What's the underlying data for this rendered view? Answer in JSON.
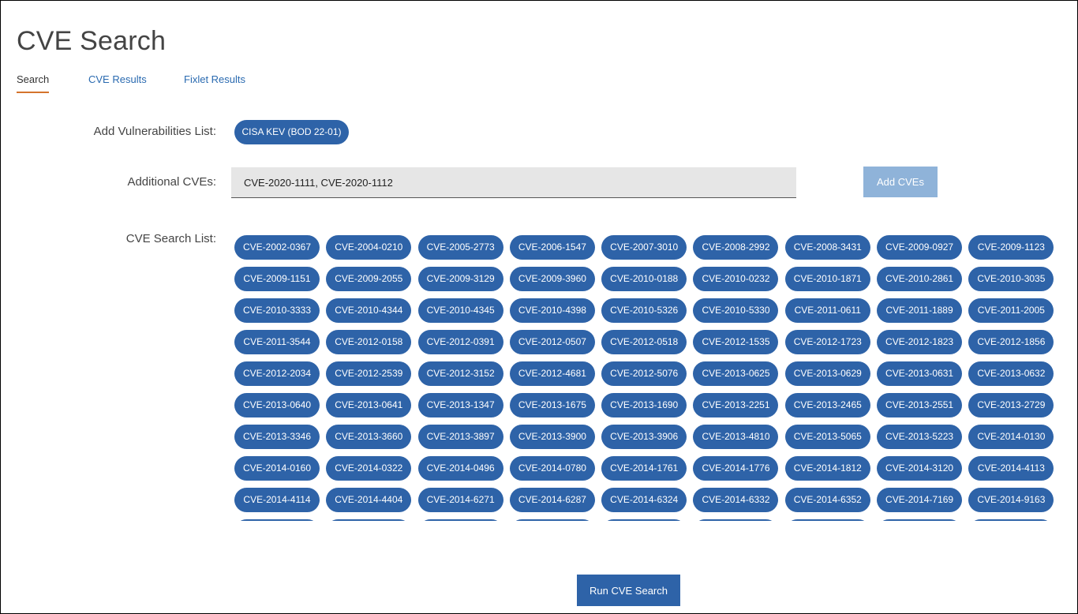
{
  "page": {
    "title": "CVE Search"
  },
  "tabs": [
    {
      "label": "Search",
      "active": true
    },
    {
      "label": "CVE Results",
      "active": false
    },
    {
      "label": "Fixlet Results",
      "active": false
    }
  ],
  "vuln_list": {
    "label": "Add Vulnerabilities List:",
    "button_label": "CISA KEV (BOD 22-01)"
  },
  "additional": {
    "label": "Additional CVEs:",
    "value": "CVE-2020-1111, CVE-2020-1112",
    "add_button": "Add CVEs"
  },
  "search_list": {
    "label": "CVE Search List:",
    "items": [
      "CVE-2002-0367",
      "CVE-2004-0210",
      "CVE-2005-2773",
      "CVE-2006-1547",
      "CVE-2007-3010",
      "CVE-2008-2992",
      "CVE-2008-3431",
      "CVE-2009-0927",
      "CVE-2009-1123",
      "CVE-2009-1151",
      "CVE-2009-2055",
      "CVE-2009-3129",
      "CVE-2009-3960",
      "CVE-2010-0188",
      "CVE-2010-0232",
      "CVE-2010-1871",
      "CVE-2010-2861",
      "CVE-2010-3035",
      "CVE-2010-3333",
      "CVE-2010-4344",
      "CVE-2010-4345",
      "CVE-2010-4398",
      "CVE-2010-5326",
      "CVE-2010-5330",
      "CVE-2011-0611",
      "CVE-2011-1889",
      "CVE-2011-2005",
      "CVE-2011-3544",
      "CVE-2012-0158",
      "CVE-2012-0391",
      "CVE-2012-0507",
      "CVE-2012-0518",
      "CVE-2012-1535",
      "CVE-2012-1723",
      "CVE-2012-1823",
      "CVE-2012-1856",
      "CVE-2012-2034",
      "CVE-2012-2539",
      "CVE-2012-3152",
      "CVE-2012-4681",
      "CVE-2012-5076",
      "CVE-2013-0625",
      "CVE-2013-0629",
      "CVE-2013-0631",
      "CVE-2013-0632",
      "CVE-2013-0640",
      "CVE-2013-0641",
      "CVE-2013-1347",
      "CVE-2013-1675",
      "CVE-2013-1690",
      "CVE-2013-2251",
      "CVE-2013-2465",
      "CVE-2013-2551",
      "CVE-2013-2729",
      "CVE-2013-3346",
      "CVE-2013-3660",
      "CVE-2013-3897",
      "CVE-2013-3900",
      "CVE-2013-3906",
      "CVE-2013-4810",
      "CVE-2013-5065",
      "CVE-2013-5223",
      "CVE-2014-0130",
      "CVE-2014-0160",
      "CVE-2014-0322",
      "CVE-2014-0496",
      "CVE-2014-0780",
      "CVE-2014-1761",
      "CVE-2014-1776",
      "CVE-2014-1812",
      "CVE-2014-3120",
      "CVE-2014-4113",
      "CVE-2014-4114",
      "CVE-2014-4404",
      "CVE-2014-6271",
      "CVE-2014-6287",
      "CVE-2014-6324",
      "CVE-2014-6332",
      "CVE-2014-6352",
      "CVE-2014-7169",
      "CVE-2014-9163"
    ],
    "partial_row_count": 9
  },
  "run_button": "Run CVE Search",
  "colors": {
    "pill": "#2e63a8",
    "add_button_disabled": "#8fb3d9",
    "tab_active_underline": "#d4742c",
    "tab_link": "#2a6ab0",
    "input_bg": "#e6e6e6"
  }
}
